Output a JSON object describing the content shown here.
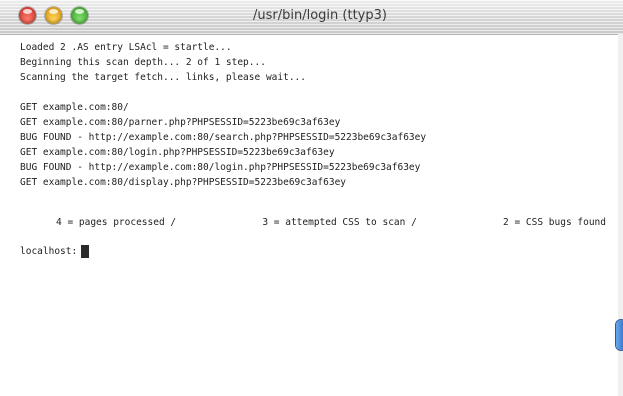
{
  "window": {
    "title": "/usr/bin/login (ttyp3)"
  },
  "terminal": {
    "header_lines": [
      "Loaded 2 .AS entry LSAcl = startle...",
      "Beginning this scan depth... 2 of 1 step...",
      "Scanning the target fetch... links, please wait..."
    ],
    "log_lines": [
      "GET example.com:80/",
      "GET example.com:80/parner.php?PHPSESSID=5223be69c3af63ey",
      "BUG FOUND - http://example.com:80/search.php?PHPSESSID=5223be69c3af63ey",
      "GET example.com:80/login.php?PHPSESSID=5223be69c3af63ey",
      "BUG FOUND - http://example.com:80/login.php?PHPSESSID=5223be69c3af63ey",
      "GET example.com:80/display.php?PHPSESSID=5223be69c3af63ey"
    ],
    "summary": {
      "pages": "4 = pages processed /",
      "attempted": "3 = attempted CSS to scan /",
      "bugs": "2 = CSS bugs found"
    },
    "prompt": "localhost:"
  },
  "colors": {
    "close": "#d8392c",
    "minimize": "#e8a316",
    "zoom": "#45b42e",
    "scroll_accent": "#3a7bd5"
  }
}
